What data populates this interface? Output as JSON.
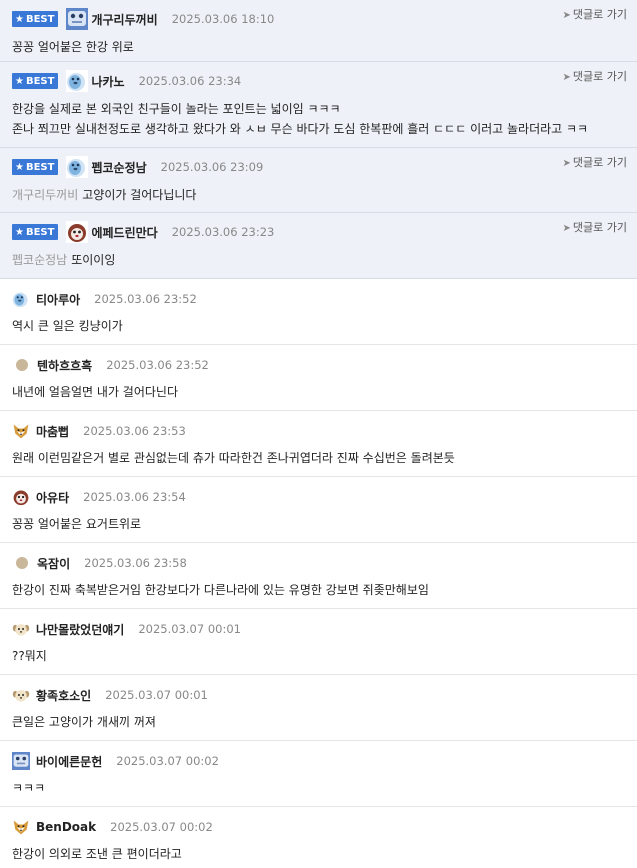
{
  "best_comments": [
    {
      "badge": "BEST",
      "avatar": "frog-avatar-icon",
      "nickname": "개구리두꺼비",
      "date": "2025.03.06 18:10",
      "reply_label": "댓글로 가기",
      "reply_to": "",
      "lines": [
        "꽁꽁 얼어붙은 한강 위로"
      ]
    },
    {
      "badge": "BEST",
      "avatar": "seal-avatar-icon",
      "nickname": "나카노",
      "date": "2025.03.06 23:34",
      "reply_label": "댓글로 가기",
      "reply_to": "",
      "lines": [
        "한강을 실제로 본 외국인 친구들이 놀라는 포인트는 넓이임 ㅋㅋㅋ",
        "존나 쬐끄만 실내천정도로 생각하고 왔다가 와 ㅅㅂ 무슨 바다가 도심 한복판에 흘러 ㄷㄷㄷ 이러고 놀라더라고 ㅋㅋ"
      ]
    },
    {
      "badge": "BEST",
      "avatar": "seal-avatar-icon",
      "nickname": "펩코순정남",
      "date": "2025.03.06 23:09",
      "reply_label": "댓글로 가기",
      "reply_to": "개구리두꺼비",
      "lines": [
        "고양이가 걸어다닙니다"
      ]
    },
    {
      "badge": "BEST",
      "avatar": "dog-face-avatar-icon",
      "nickname": "에페드린만다",
      "date": "2025.03.06 23:23",
      "reply_label": "댓글로 가기",
      "reply_to": "펩코순정남",
      "lines": [
        "또이이잉"
      ]
    }
  ],
  "comments": [
    {
      "avatar": "seal-avatar-icon",
      "nickname": "티아루아",
      "date": "2025.03.06 23:52",
      "text": "역시 큰 일은 킹냥이가"
    },
    {
      "avatar": "dot-avatar-icon",
      "nickname": "텐하흐흐흑",
      "date": "2025.03.06 23:52",
      "text": "내년에 얼음얼면 내가 걸어다닌다"
    },
    {
      "avatar": "fox-avatar-icon",
      "nickname": "마춤뻡",
      "date": "2025.03.06 23:53",
      "text": "원래 이런밈같은거 별로 관심없는데 츄가 따라한건 존나귀엽더라 진짜 수십번은 돌려본듯"
    },
    {
      "avatar": "dog-face-avatar-icon",
      "nickname": "아유타",
      "date": "2025.03.06 23:54",
      "text": "꽁꽁 얼어붙은 요거트위로"
    },
    {
      "avatar": "dot-avatar-icon",
      "nickname": "옥잠이",
      "date": "2025.03.06 23:58",
      "text": "한강이 진짜 축복받은거임 한강보다가 다른나라에 있는 유명한 강보면 쥐좆만해보임"
    },
    {
      "avatar": "puppy-avatar-icon",
      "nickname": "나만몰랐었던얘기",
      "date": "2025.03.07 00:01",
      "text": "??뭐지"
    },
    {
      "avatar": "puppy-avatar-icon",
      "nickname": "황족호소인",
      "date": "2025.03.07 00:01",
      "text": "큰일은 고양이가 개새끼 꺼져"
    },
    {
      "avatar": "frog-avatar-icon",
      "nickname": "바이에른문헌",
      "date": "2025.03.07 00:02",
      "text": "ㅋㅋㅋ"
    },
    {
      "avatar": "fox-avatar-icon",
      "nickname": "BenDoak",
      "date": "2025.03.07 00:02",
      "text": "한강이 의외로 조낸 큰 편이더라고"
    }
  ]
}
